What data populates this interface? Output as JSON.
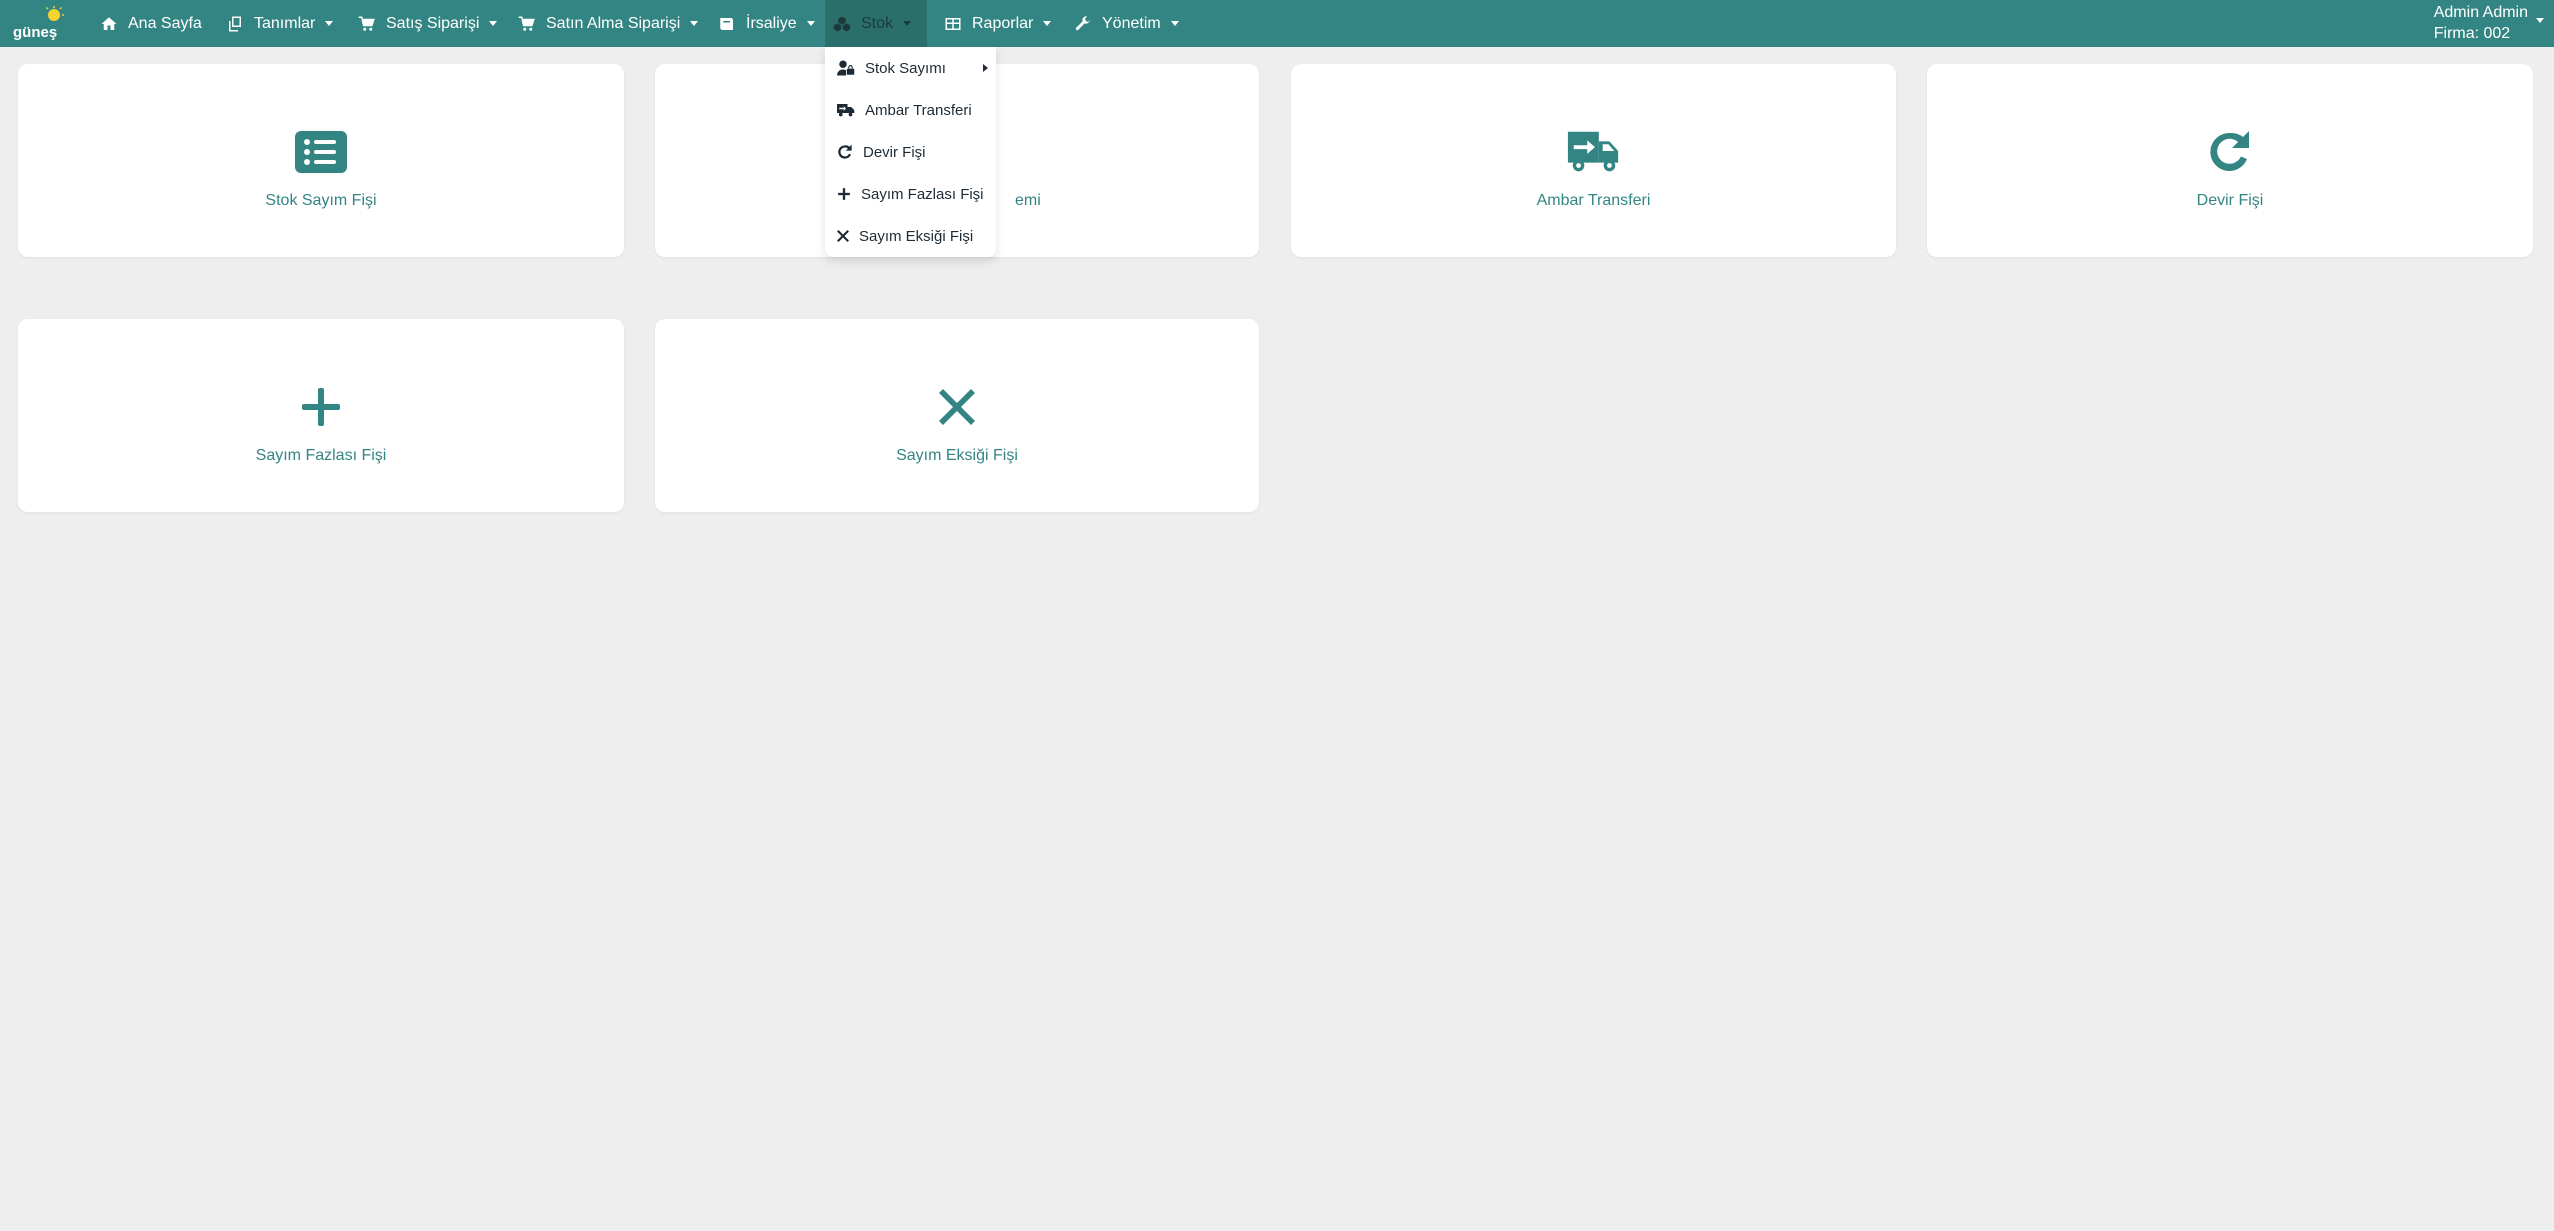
{
  "brand": {
    "logo_text": "güneş",
    "colors": {
      "primary": "#338583",
      "background": "#eeeeee",
      "card": "#ffffff"
    }
  },
  "nav": {
    "items": [
      {
        "label": "Ana Sayfa",
        "icon": "home-icon",
        "has_dropdown": false
      },
      {
        "label": "Tanımlar",
        "icon": "copy-icon",
        "has_dropdown": true
      },
      {
        "label": "Satış Siparişi",
        "icon": "cart-icon",
        "has_dropdown": true
      },
      {
        "label": "Satın Alma Siparişi",
        "icon": "cart-icon",
        "has_dropdown": true
      },
      {
        "label": "İrsaliye",
        "icon": "book-icon",
        "has_dropdown": true
      },
      {
        "label": "Stok",
        "icon": "cubes-icon",
        "has_dropdown": true,
        "active": true
      },
      {
        "label": "Raporlar",
        "icon": "table-icon",
        "has_dropdown": true
      },
      {
        "label": "Yönetim",
        "icon": "wrench-icon",
        "has_dropdown": true
      }
    ]
  },
  "user": {
    "name": "Admin Admin",
    "company": "Firma: 002"
  },
  "stok_menu": {
    "items": [
      {
        "label": "Stok Sayımı",
        "icon": "user-lock-icon",
        "has_submenu": true
      },
      {
        "label": "Ambar Transferi",
        "icon": "truck-icon"
      },
      {
        "label": "Devir Fişi",
        "icon": "rotate-icon"
      },
      {
        "label": "Sayım Fazlası Fişi",
        "icon": "plus-icon"
      },
      {
        "label": "Sayım Eksiği Fişi",
        "icon": "close-icon"
      }
    ]
  },
  "cards": [
    {
      "label": "Stok Sayım Fişi",
      "icon": "list-icon"
    },
    {
      "label": "emi",
      "icon": "hidden-icon"
    },
    {
      "label": "Ambar Transferi",
      "icon": "truck-arrow-icon"
    },
    {
      "label": "Devir Fişi",
      "icon": "rotate-icon"
    },
    {
      "label": "Sayım Fazlası Fişi",
      "icon": "plus-icon"
    },
    {
      "label": "Sayım Eksiği Fişi",
      "icon": "close-icon"
    }
  ]
}
